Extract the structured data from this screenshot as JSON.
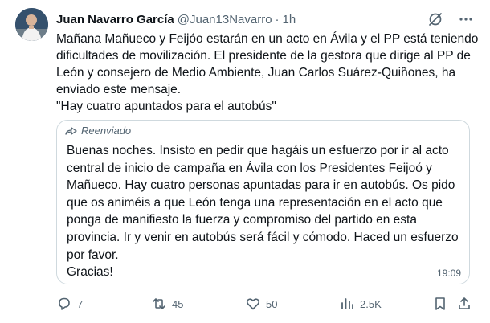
{
  "author": {
    "name": "Juan Navarro García",
    "handle": "@Juan13Navarro",
    "time": "1h"
  },
  "tweet": {
    "lines": [
      "Mañana Mañueco y Feijóo estarán en un acto en Ávila y el PP está teniendo",
      "dificultades de movilización. El presidente de la gestora que dirige al PP de",
      "León y consejero de Medio Ambiente, Juan Carlos Suárez-Quiñones, ha",
      "enviado este mensaje.",
      "\"Hay cuatro apuntados para el autobús\""
    ]
  },
  "quote": {
    "forwarded_label": "Reenviado",
    "lines": [
      "Buenas noches. Insisto en pedir que hagáis un esfuerzo por ir al acto",
      "central de inicio de campaña en Ávila con los Presidentes Feijoó y",
      "Mañueco. Hay cuatro personas apuntadas para ir en autobús. Os pido",
      "que os animéis a que León tenga una representación en el acto que",
      "ponga de manifiesto la fuerza y compromiso del partido en esta",
      "provincia. Ir y venir en autobús será fácil y cómodo. Haced un esfuerzo",
      "por favor.",
      "Gracias!"
    ],
    "time": "19:09"
  },
  "actions": {
    "replies": "7",
    "reposts": "45",
    "likes": "50",
    "views": "2.5K"
  },
  "icons": {
    "header": [
      "grok-icon",
      "more-icon"
    ],
    "actions": [
      "reply-icon",
      "repost-icon",
      "like-icon",
      "views-icon",
      "bookmark-icon",
      "share-icon"
    ]
  },
  "colors": {
    "text": "#0f1419",
    "secondary": "#536471",
    "border": "#cfd9de"
  }
}
